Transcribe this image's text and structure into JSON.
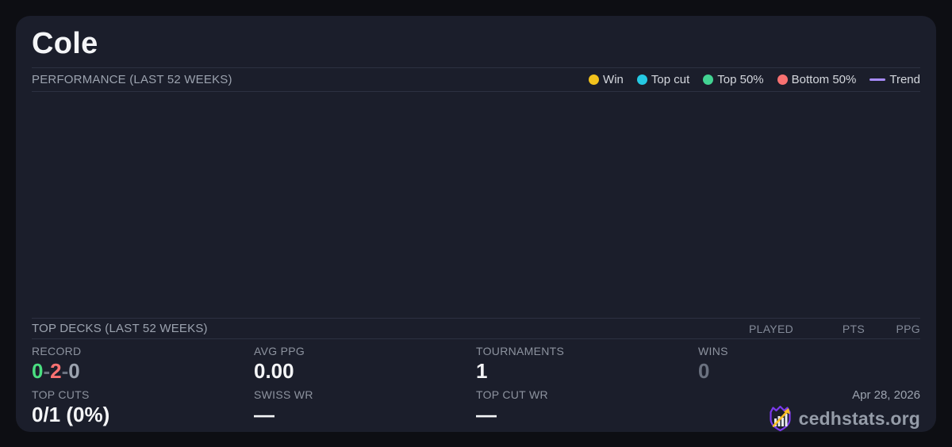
{
  "player": {
    "name": "Cole"
  },
  "performance": {
    "header": "PERFORMANCE (LAST 52 WEEKS)",
    "legend": [
      {
        "label": "Win",
        "marker": "dot",
        "color": "#f2c21c"
      },
      {
        "label": "Top cut",
        "marker": "dot",
        "color": "#25c9e3"
      },
      {
        "label": "Top 50%",
        "marker": "dot",
        "color": "#42d392"
      },
      {
        "label": "Bottom 50%",
        "marker": "dot",
        "color": "#f87171"
      },
      {
        "label": "Trend",
        "marker": "line",
        "color": "#a78bfa"
      }
    ],
    "chart_data": {
      "type": "scatter",
      "title": "PERFORMANCE (LAST 52 WEEKS)",
      "series": [],
      "legend_position": "top-right",
      "grid": false
    }
  },
  "top_decks": {
    "header": "TOP DECKS (LAST 52 WEEKS)",
    "columns": [
      "PLAYED",
      "PTS",
      "PPG"
    ],
    "rows": []
  },
  "stats": {
    "record": {
      "label": "RECORD",
      "parts": [
        "0",
        "-",
        "2",
        "-",
        "0"
      ],
      "part_colors": [
        "#4ade80",
        "#6b7280",
        "#f87171",
        "#6b7280",
        "#9ca3af"
      ]
    },
    "avg_ppg": {
      "label": "AVG PPG",
      "value": "0.00"
    },
    "tournaments": {
      "label": "TOURNAMENTS",
      "value": "1"
    },
    "wins": {
      "label": "WINS",
      "value": "0",
      "value_color": "#6b7280"
    },
    "top_cuts": {
      "label": "TOP CUTS",
      "value": "0/1 (0%)"
    },
    "swiss_wr": {
      "label": "SWISS WR",
      "value": "—"
    },
    "top_cut_wr": {
      "label": "TOP CUT WR",
      "value": "—"
    }
  },
  "footer": {
    "date": "Apr 28, 2026",
    "brand": "cedhstats.org",
    "logo_icon": "shield-bar-chart-arrow-icon",
    "logo_colors": {
      "shield": "#7c3aed",
      "bars": "#e5e7eb",
      "arrow": "#fbbf24"
    }
  },
  "colors": {
    "page_bg": "#0d0e13",
    "card_bg": "#1b1e2b",
    "divider": "#2d3142"
  }
}
